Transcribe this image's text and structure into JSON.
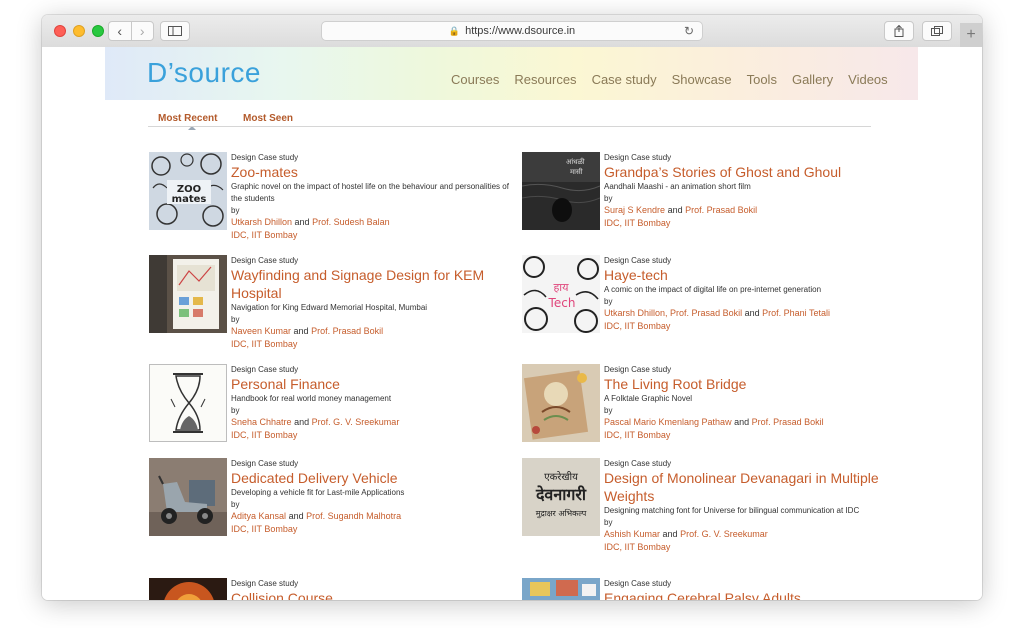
{
  "browser": {
    "url": "https://www.dsource.in"
  },
  "site": {
    "logo": "D’source",
    "nav": [
      "Courses",
      "Resources",
      "Case study",
      "Showcase",
      "Tools",
      "Gallery",
      "Videos"
    ]
  },
  "tabs": [
    "Most Recent",
    "Most Seen"
  ],
  "cards": [
    {
      "category": "Design Case study",
      "title": "Zoo-mates",
      "desc": "Graphic novel on the impact of hostel life on the behaviour and personalities of the students",
      "by": "by",
      "author1": "Utkarsh Dhillon",
      "and1": "and",
      "author2": "Prof. Sudesh Balan",
      "inst": "IDC, IIT Bombay"
    },
    {
      "category": "Design Case study",
      "title": "Grandpa’s Stories of Ghost and Ghoul",
      "desc": "Aandhali Maashi - an animation short film",
      "by": "by",
      "author1": "Suraj S Kendre",
      "and1": "and",
      "author2": "Prof. Prasad Bokil",
      "inst": "IDC, IIT Bombay"
    },
    {
      "category": "Design Case study",
      "title": "Wayfinding and Signage Design for KEM Hospital",
      "desc": "Navigation for King Edward Memorial Hospital, Mumbai",
      "by": "by",
      "author1": "Naveen Kumar",
      "and1": "and",
      "author2": "Prof. Prasad Bokil",
      "inst": "IDC, IIT Bombay"
    },
    {
      "category": "Design Case study",
      "title": "Haye-tech",
      "desc": "A comic on the impact of digital life on pre-internet generation",
      "by": "by",
      "author1": "Utkarsh Dhillon,",
      "author2": "Prof. Prasad Bokil",
      "and1": "and",
      "author3": "Prof. Phani Tetali",
      "inst": "IDC, IIT Bombay"
    },
    {
      "category": "Design Case study",
      "title": "Personal Finance",
      "desc": "Handbook for real world money management",
      "by": "by",
      "author1": "Sneha Chhatre",
      "and1": "and",
      "author2": "Prof. G. V. Sreekumar",
      "inst": "IDC, IIT Bombay"
    },
    {
      "category": "Design Case study",
      "title": "The Living Root Bridge",
      "desc": "A Folktale Graphic Novel",
      "by": "by",
      "author1": "Pascal Mario Kmenlang Pathaw",
      "and1": "and",
      "author2": "Prof. Prasad Bokil",
      "inst": "IDC, IIT Bombay"
    },
    {
      "category": "Design Case study",
      "title": "Dedicated Delivery Vehicle",
      "desc": "Developing a vehicle fit for Last-mile Applications",
      "by": "by",
      "author1": "Aditya Kansal",
      "and1": "and",
      "author2": "Prof. Sugandh Malhotra",
      "inst": "IDC, IIT Bombay"
    },
    {
      "category": "Design Case study",
      "title": "Design of Monolinear Devanagari in Multiple Weights",
      "desc": "Designing matching font for Universe for bilingual communication at IDC",
      "by": "by",
      "author1": "Ashish Kumar",
      "and1": "and",
      "author2": "Prof. G. V. Sreekumar",
      "inst": "IDC, IIT Bombay",
      "thumb_text_top": "एकरेखीय",
      "thumb_text_mid": "देवनागरी",
      "thumb_text_bot": "मुद्राक्षर अभिकल्प"
    },
    {
      "category": "Design Case study",
      "title": "Collision Course"
    },
    {
      "category": "Design Case study",
      "title": "Engaging Cerebral Palsy Adults"
    }
  ]
}
